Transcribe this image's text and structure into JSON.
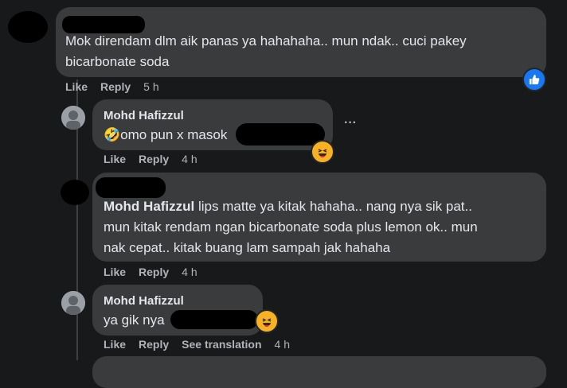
{
  "comments": [
    {
      "author": "",
      "text": "Mok direndam dlm aik panas ya hahahaha.. mun ndak.. cuci pakey bicarbonate soda",
      "like": "Like",
      "reply": "Reply",
      "time": "5 h",
      "reaction": "like"
    },
    {
      "author": "Mohd Hafizzul",
      "text_prefix": "🤣omo pun x masok",
      "like": "Like",
      "reply": "Reply",
      "time": "4 h",
      "reaction": "laugh"
    },
    {
      "author": "Mohd Hafizzul",
      "text_line1": "lips matte ya kitak hahaha.. nang nya sik pat..",
      "text_line2": "mun kitak rendam ngan bicarbonate soda plus lemon ok.. mun",
      "text_line3": "nak cepat.. kitak buang lam sampah jak hahaha",
      "like": "Like",
      "reply": "Reply",
      "time": "4 h"
    },
    {
      "author": "Mohd Hafizzul",
      "text_prefix": "ya gik nya",
      "like": "Like",
      "reply": "Reply",
      "see_translation": "See translation",
      "time": "4 h",
      "reaction": "laugh"
    }
  ],
  "more_options": "···"
}
